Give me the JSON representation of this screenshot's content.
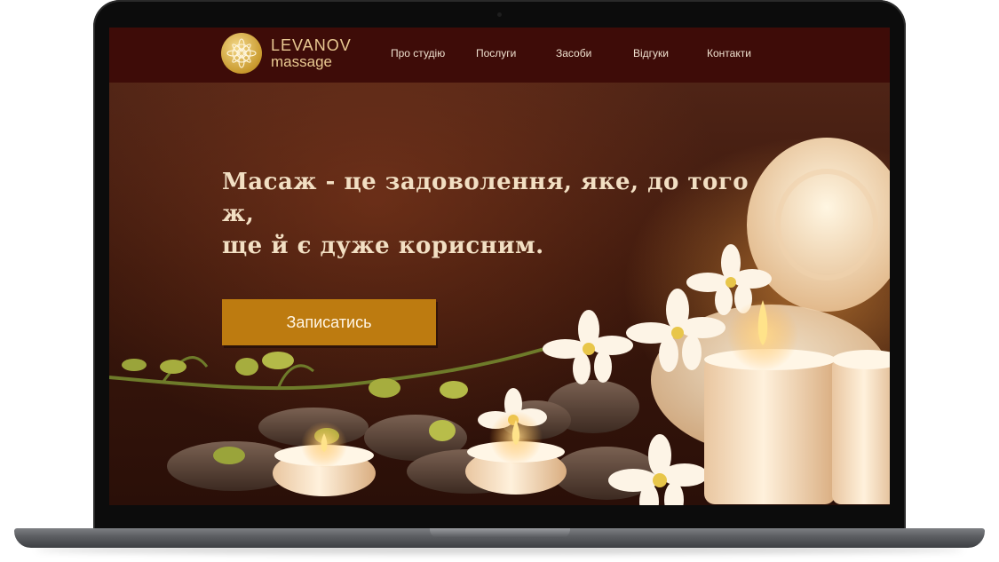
{
  "brand": {
    "name": "LEVANOV",
    "tagline": "massage",
    "logo_icon": "mandala-icon",
    "color": "#d4a63d"
  },
  "nav": {
    "items": [
      {
        "label": "Про студію"
      },
      {
        "label": "Послуги"
      },
      {
        "label": "Засоби"
      },
      {
        "label": "Відгуки"
      },
      {
        "label": "Контакти"
      }
    ]
  },
  "hero": {
    "headline_line1": "Масаж - це задоволення, яке, до того ж,",
    "headline_line2": "ще й є дуже корисним.",
    "cta_label": "Записатись",
    "image": "spa-candles-orchids-stones-towels"
  },
  "colors": {
    "header_bg": "#3e0c08",
    "cta_bg": "#bd7b10",
    "headline_text": "#f2dfc3",
    "nav_text": "#efe1cf"
  }
}
